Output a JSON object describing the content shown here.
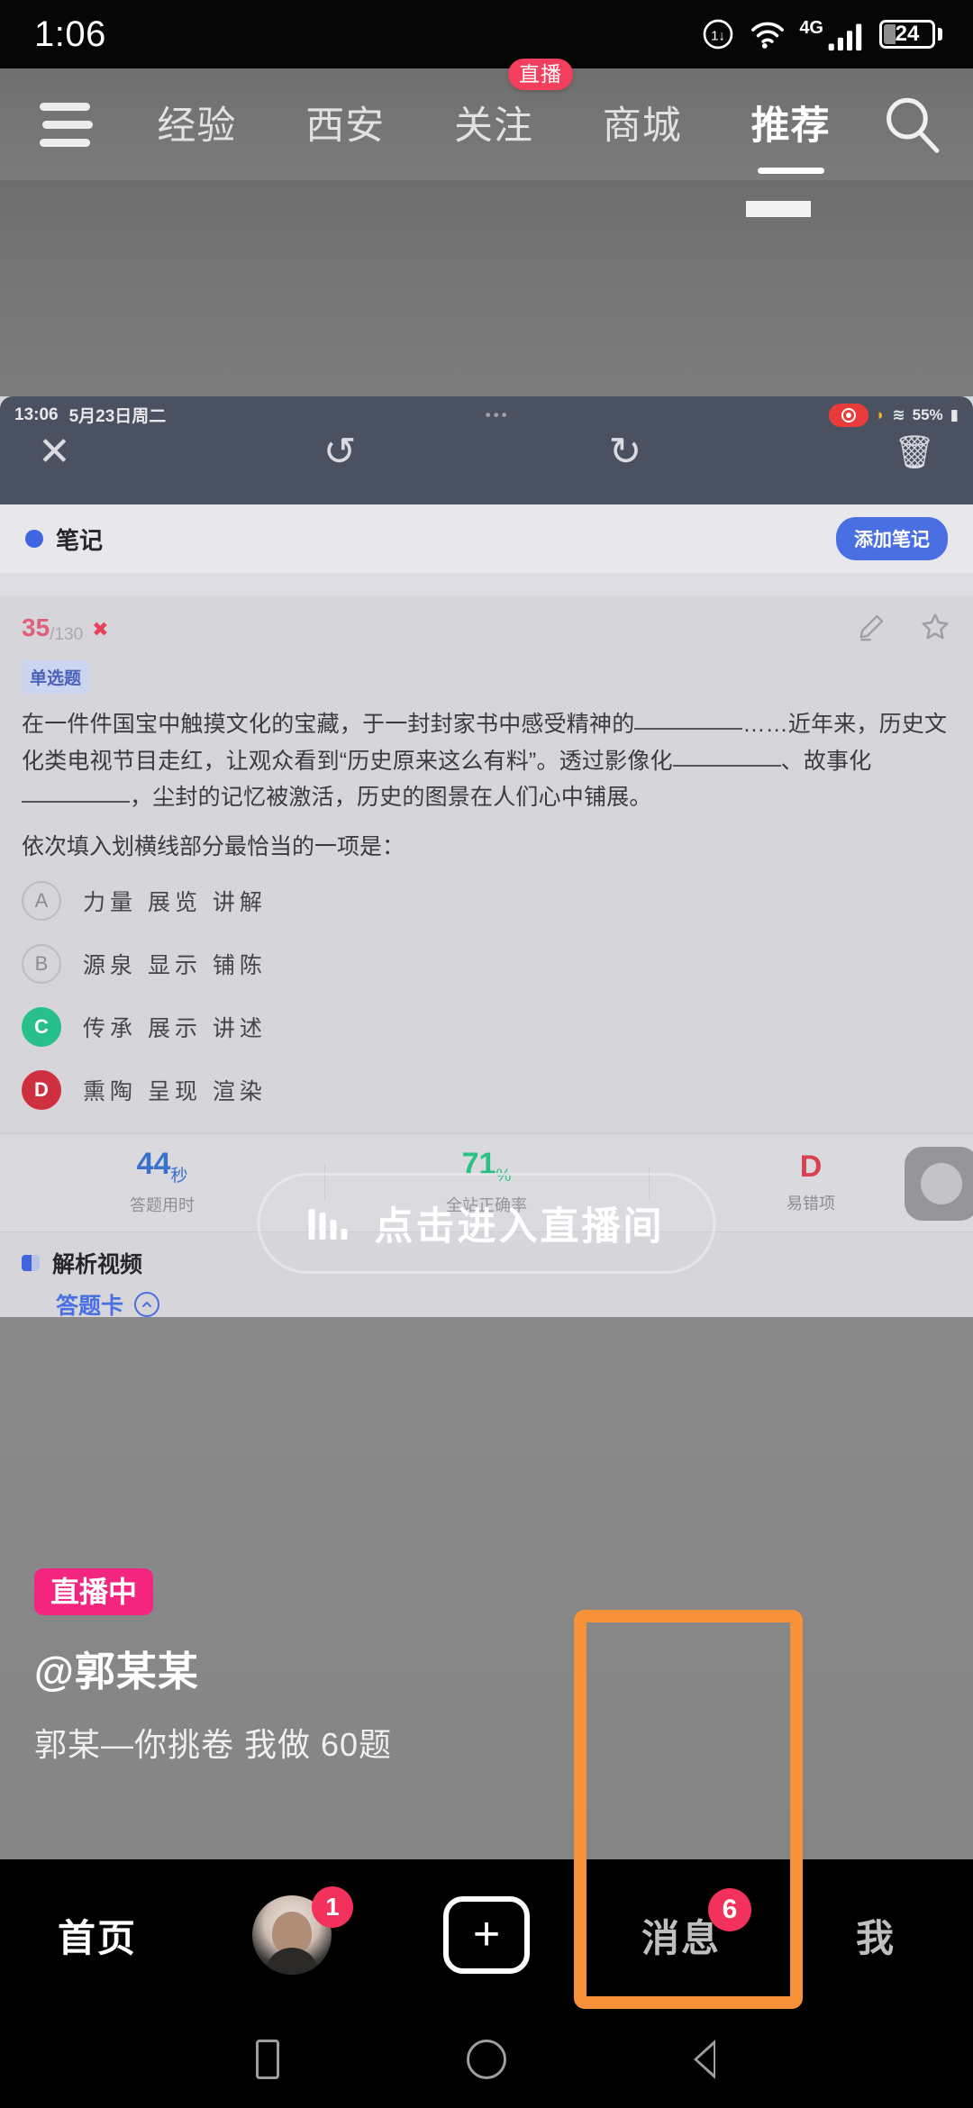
{
  "status_bar": {
    "time": "1:06",
    "battery_level": "24",
    "network": "4G",
    "icons": [
      "power-saving-icon",
      "wifi-icon",
      "signal-icon",
      "battery-icon"
    ]
  },
  "top_nav": {
    "menu_icon": "hamburger-icon",
    "search_icon": "search-icon",
    "tabs": [
      {
        "label": "经验",
        "active": false,
        "badge": null
      },
      {
        "label": "西安",
        "active": false,
        "badge": null
      },
      {
        "label": "关注",
        "active": false,
        "badge": "直播"
      },
      {
        "label": "商城",
        "active": false,
        "badge": null
      },
      {
        "label": "推荐",
        "active": true,
        "badge": null
      }
    ]
  },
  "embedded_screenshot": {
    "status": {
      "time": "13:06",
      "date": "5月23日周二",
      "dots": "•••",
      "recording_icon": "record-icon",
      "battery": "55%"
    },
    "toolbar": {
      "close": "✕",
      "undo": "↺",
      "redo": "↻",
      "delete": "🗑"
    },
    "note_header": {
      "title": "笔记",
      "add_button": "添加笔记"
    },
    "question": {
      "index": "35",
      "total": "/130",
      "wrong_mark": "✖",
      "type_tag": "单选题",
      "edit_icon": "pencil-icon",
      "star_icon": "star-icon",
      "text_part1": "在一件件国宝中触摸文化的宝藏，于一封封家书中感受精神的",
      "text_part2": "……近年来，历史文化类电视节目走红，让观众看到“历史原来这么有料”。透过影像化",
      "text_part3": "、故事化",
      "text_part4": "，尘封的记忆被激活，历史的图景在人们心中铺展。",
      "prompt": "依次填入划横线部分最恰当的一项是：",
      "options": [
        {
          "key": "A",
          "text": "力量  展览  讲解",
          "state": "none"
        },
        {
          "key": "B",
          "text": "源泉  显示  铺陈",
          "state": "none"
        },
        {
          "key": "C",
          "text": "传承  展示  讲述",
          "state": "correct"
        },
        {
          "key": "D",
          "text": "熏陶  呈现  渲染",
          "state": "wrong"
        }
      ]
    },
    "stats": [
      {
        "value": "44",
        "unit": "秒",
        "label": "答题用时",
        "color": "blue"
      },
      {
        "value": "71",
        "unit": "%",
        "label": "全站正确率",
        "color": "green"
      },
      {
        "value": "D",
        "unit": "",
        "label": "易错项",
        "color": "red"
      }
    ],
    "footer": {
      "video_label": "解析视频",
      "answer_sheet_label": "答题卡",
      "chevron_icon": "chevron-up-icon"
    },
    "floating_button": "shutter-button"
  },
  "live_overlay": {
    "enter_button": "点击进入直播间",
    "equalizer_icon": "audio-bars-icon",
    "live_badge": "直播中",
    "handle": "@郭某某",
    "subtitle": "郭某—你挑卷 我做 60题"
  },
  "tab_bar": {
    "items": [
      {
        "label": "首页",
        "type": "text",
        "badge": null,
        "active": true
      },
      {
        "label": "",
        "type": "avatar",
        "badge": "1",
        "active": false
      },
      {
        "label": "+",
        "type": "plus",
        "badge": null,
        "active": false
      },
      {
        "label": "消息",
        "type": "text",
        "badge": "6",
        "active": false
      },
      {
        "label": "我",
        "type": "text",
        "badge": null,
        "active": false
      }
    ]
  },
  "system_nav": {
    "recents_icon": "square-recents-icon",
    "home_icon": "circle-home-icon",
    "back_icon": "triangle-back-icon"
  },
  "annotation": {
    "highlight_color": "#f79238",
    "target": "消息"
  }
}
